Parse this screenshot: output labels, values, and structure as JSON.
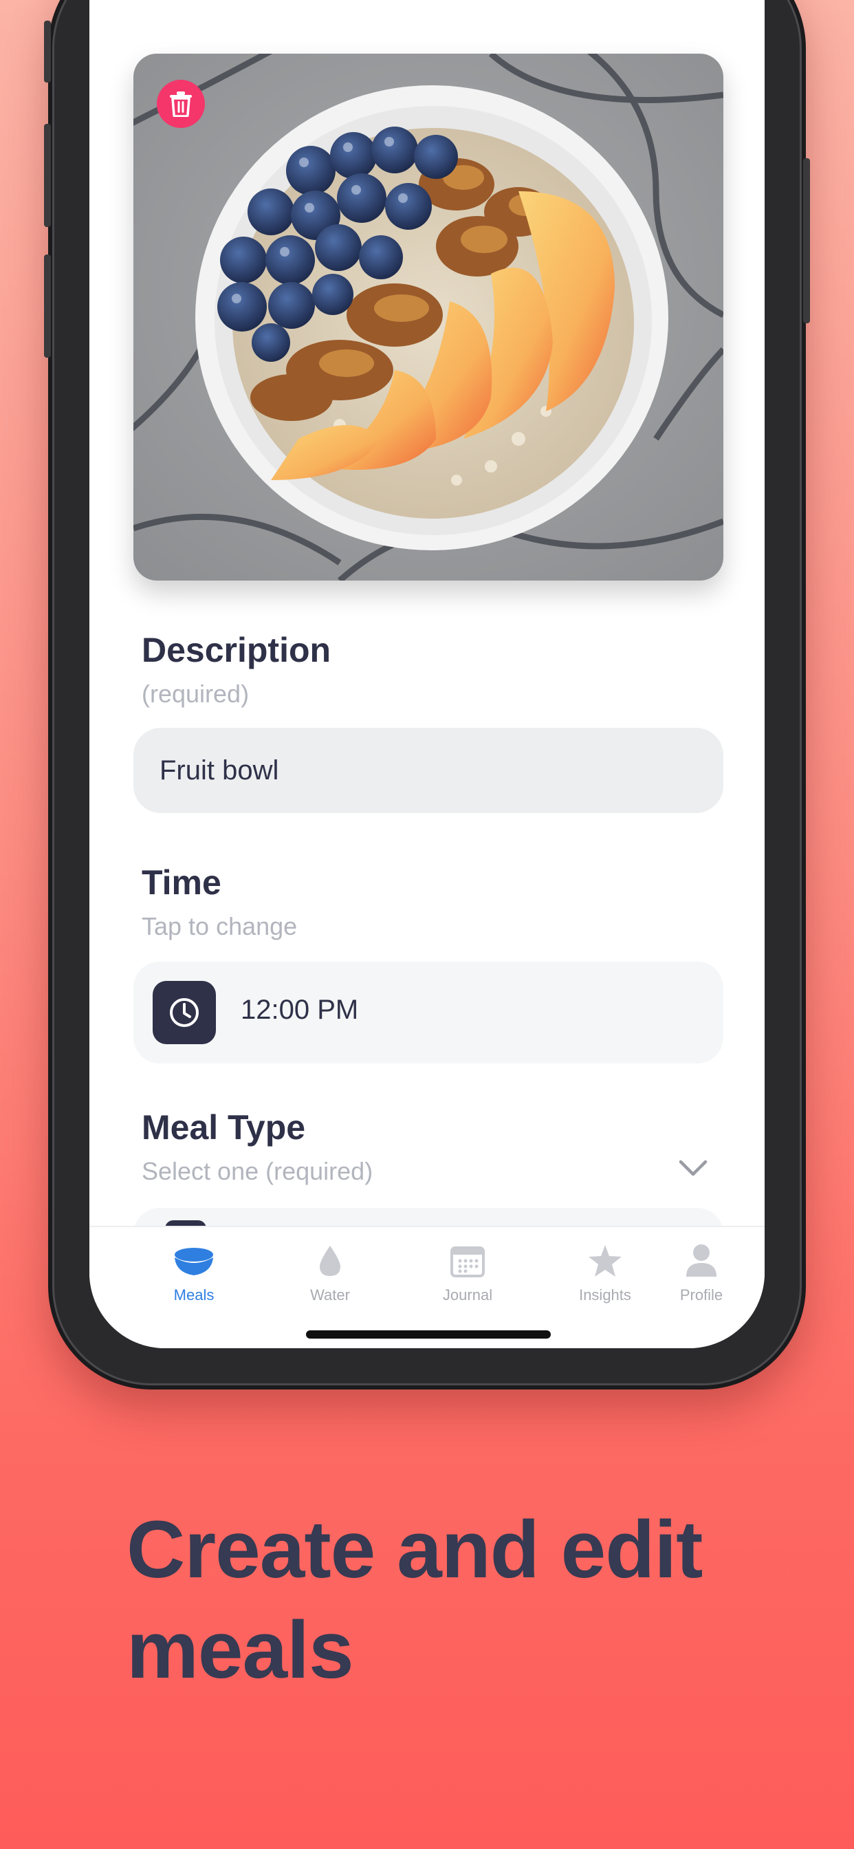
{
  "photo": {
    "alt": "Oatmeal bowl with blueberries, walnuts and peach slices",
    "delete_icon": "trash-icon",
    "delete_color": "#f4366b"
  },
  "description": {
    "title": "Description",
    "subtitle": "(required)",
    "value": "Fruit bowl"
  },
  "time": {
    "title": "Time",
    "subtitle": "Tap to change",
    "value": "12:00 PM",
    "icon": "clock-icon"
  },
  "meal_type": {
    "title": "Meal Type",
    "subtitle": "Select one (required)",
    "icon": "chevron-down-icon"
  },
  "tabbar": {
    "active_color": "#2f7fe1",
    "inactive_color": "#a9abb2",
    "items": [
      {
        "label": "Meals",
        "icon": "bowl-icon",
        "active": true
      },
      {
        "label": "Water",
        "icon": "water-drop-icon",
        "active": false
      },
      {
        "label": "Journal",
        "icon": "calendar-icon",
        "active": false
      },
      {
        "label": "Insights",
        "icon": "star-icon",
        "active": false
      },
      {
        "label": "Profile",
        "icon": "person-icon",
        "active": false
      }
    ]
  },
  "headline": "Create and edit meals",
  "colors": {
    "text_dark": "#2e3148",
    "text_muted": "#b2b5bd",
    "input_bg": "#eceef0",
    "background_top": "#fbb4a6",
    "background_bottom": "#fe5c5a"
  }
}
